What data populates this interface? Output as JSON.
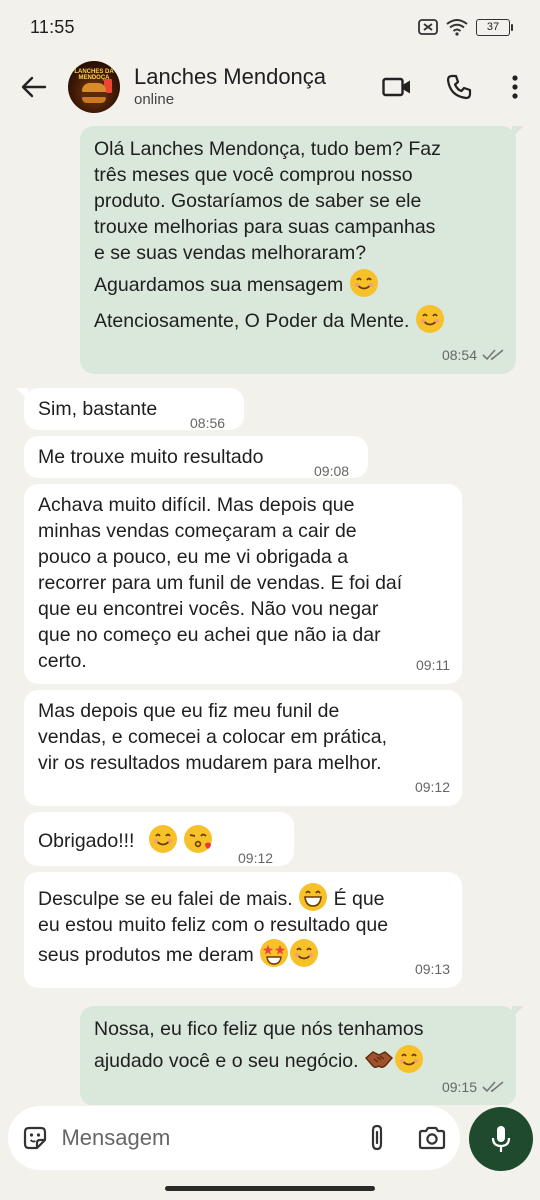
{
  "status_bar": {
    "time": "11:55",
    "battery": "37"
  },
  "header": {
    "contact_name": "Lanches Mendonça",
    "contact_status": "online",
    "avatar_text": "LANCHES DA MENDOÇA"
  },
  "messages": [
    {
      "direction": "out",
      "lines": [
        "Olá Lanches Mendonça, tudo bem? Faz",
        "três meses que você comprou nosso",
        "produto. Gostaríamos de saber se ele",
        "trouxe melhorias para suas campanhas",
        "e se suas vendas melhoraram?",
        "Aguardamos sua mensagem",
        "Atenciosamente, O Poder da Mente."
      ],
      "time": "08:54"
    },
    {
      "direction": "in",
      "text": "Sim, bastante",
      "time": "08:56"
    },
    {
      "direction": "in",
      "text": "Me trouxe muito resultado",
      "time": "09:08"
    },
    {
      "direction": "in",
      "lines": [
        "Achava muito difícil. Mas depois que",
        "minhas vendas começaram a cair de",
        "pouco a pouco, eu me vi obrigada a",
        "recorrer para um funil de vendas. E foi daí",
        "que eu encontrei vocês. Não vou negar",
        "que no começo eu achei que não ia dar",
        "certo."
      ],
      "time": "09:11"
    },
    {
      "direction": "in",
      "lines": [
        "Mas depois que eu fiz meu funil de",
        "vendas, e comecei a colocar em prática,",
        "vir os resultados mudarem para melhor."
      ],
      "time": "09:12"
    },
    {
      "direction": "in",
      "text": "Obrigado!!!",
      "time": "09:12"
    },
    {
      "direction": "in",
      "lines": [
        "Desculpe se eu falei de mais.",
        "É que",
        "eu estou muito feliz com o resultado que",
        "seus produtos me deram"
      ],
      "time": "09:13"
    },
    {
      "direction": "out",
      "lines": [
        "Nossa, eu fico feliz que nós tenhamos",
        "ajudado você e o seu negócio."
      ],
      "time": "09:15"
    }
  ],
  "input": {
    "placeholder": "Mensagem"
  },
  "colors": {
    "background": "#f2f1ec",
    "outgoing_bubble": "#d9e8da",
    "incoming_bubble": "#ffffff",
    "mic_button": "#1f4a2e"
  }
}
